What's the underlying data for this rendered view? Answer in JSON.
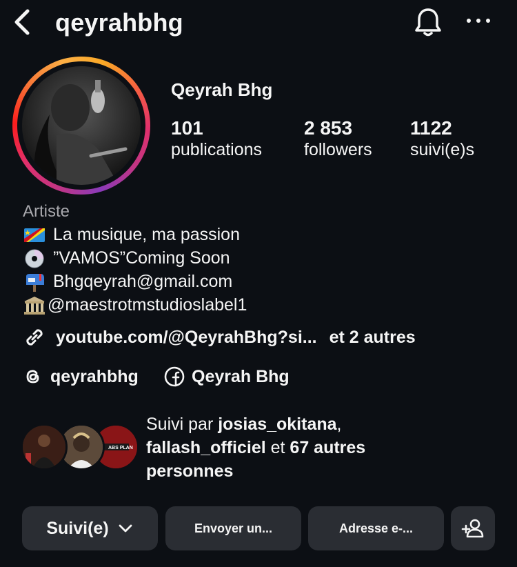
{
  "header": {
    "username": "qeyrahbhg",
    "icons": {
      "back": "chevron-left-icon",
      "notifications": "bell-icon",
      "more": "more-horizontal-icon"
    }
  },
  "profile": {
    "display_name": "Qeyrah Bhg",
    "stats": [
      {
        "value": "101",
        "label": "publications"
      },
      {
        "value": "2 853",
        "label": "followers"
      },
      {
        "value": "1122",
        "label": "suivi(e)s"
      }
    ],
    "category": "Artiste",
    "bio": [
      {
        "icon": "flag-drc-icon",
        "text": "La musique, ma passion"
      },
      {
        "icon": "cd-icon",
        "text": "”VAMOS”Coming Soon"
      },
      {
        "icon": "mailbox-icon",
        "text": "Bhgqeyrah@gmail.com"
      },
      {
        "icon": "classical-building-icon",
        "text": "@maestrotmstudioslabel1"
      }
    ],
    "link": {
      "url_text": "youtube.com/@QeyrahBhg?si...",
      "extra": "et 2 autres"
    },
    "threads_handle": "qeyrahbhg",
    "facebook_name": "Qeyrah Bhg"
  },
  "followed_by": {
    "prefix": "Suivi par ",
    "user1": "josias_okitana",
    "sep": ",",
    "user2": "fallash_officiel",
    "mid": " et ",
    "rest": "67 autres personnes"
  },
  "actions": {
    "following": "Suivi(e)",
    "message": "Envoyer un...",
    "email": "Adresse e-...",
    "add_icon": "add-person-icon"
  },
  "colors": {
    "background": "#0c0f14",
    "button": "#2a2d33",
    "muted": "#a8a8ad"
  }
}
